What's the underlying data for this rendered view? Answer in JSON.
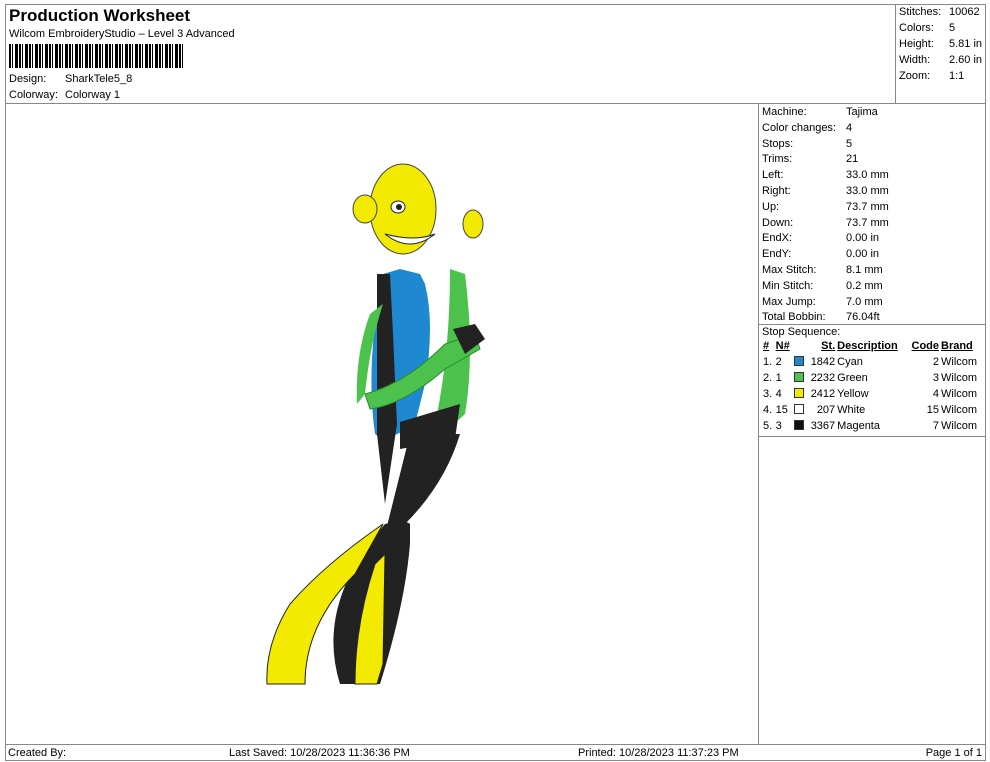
{
  "header": {
    "title": "Production Worksheet",
    "subtitle": "Wilcom EmbroideryStudio – Level 3 Advanced",
    "design_label": "Design:",
    "design": "SharkTele5_8",
    "colorway_label": "Colorway:",
    "colorway": "Colorway 1"
  },
  "stats": [
    {
      "k": "Stitches:",
      "v": "10062"
    },
    {
      "k": "Colors:",
      "v": "5"
    },
    {
      "k": "Height:",
      "v": "5.81 in"
    },
    {
      "k": "Width:",
      "v": "2.60 in"
    },
    {
      "k": "Zoom:",
      "v": "1:1"
    }
  ],
  "info": [
    {
      "k": "Machine:",
      "v": "Tajima"
    },
    {
      "k": "Color changes:",
      "v": "4"
    },
    {
      "k": "Stops:",
      "v": "5"
    },
    {
      "k": "Trims:",
      "v": "21"
    },
    {
      "k": "Left:",
      "v": "33.0 mm"
    },
    {
      "k": "Right:",
      "v": "33.0 mm"
    },
    {
      "k": "Up:",
      "v": "73.7 mm"
    },
    {
      "k": "Down:",
      "v": "73.7 mm"
    },
    {
      "k": "EndX:",
      "v": "0.00 in"
    },
    {
      "k": "EndY:",
      "v": "0.00 in"
    },
    {
      "k": "Max Stitch:",
      "v": "8.1 mm"
    },
    {
      "k": "Min Stitch:",
      "v": "0.2 mm"
    },
    {
      "k": "Max Jump:",
      "v": "7.0 mm"
    },
    {
      "k": "Total Bobbin:",
      "v": "76.04ft"
    }
  ],
  "stop_sequence": {
    "title": "Stop Sequence:",
    "headers": [
      "#",
      "N#",
      "St.",
      "Description",
      "Code",
      "Brand"
    ],
    "rows": [
      {
        "n": "1.",
        "needle": "2",
        "color": "#1e88d0",
        "st": "1842",
        "desc": "Cyan",
        "code": "2",
        "brand": "Wilcom"
      },
      {
        "n": "2.",
        "needle": "1",
        "color": "#4cc24c",
        "st": "2232",
        "desc": "Green",
        "code": "3",
        "brand": "Wilcom"
      },
      {
        "n": "3.",
        "needle": "4",
        "color": "#f2ea00",
        "st": "2412",
        "desc": "Yellow",
        "code": "4",
        "brand": "Wilcom"
      },
      {
        "n": "4.",
        "needle": "15",
        "color": "#ffffff",
        "st": "207",
        "desc": "White",
        "code": "15",
        "brand": "Wilcom"
      },
      {
        "n": "5.",
        "needle": "3",
        "color": "#111111",
        "st": "3367",
        "desc": "Magenta",
        "code": "7",
        "brand": "Wilcom"
      }
    ]
  },
  "footer": {
    "created": "Created By:",
    "saved": "Last Saved: 10/28/2023 11:36:36 PM",
    "printed": "Printed: 10/28/2023 11:37:23 PM",
    "page": "Page 1 of 1"
  }
}
